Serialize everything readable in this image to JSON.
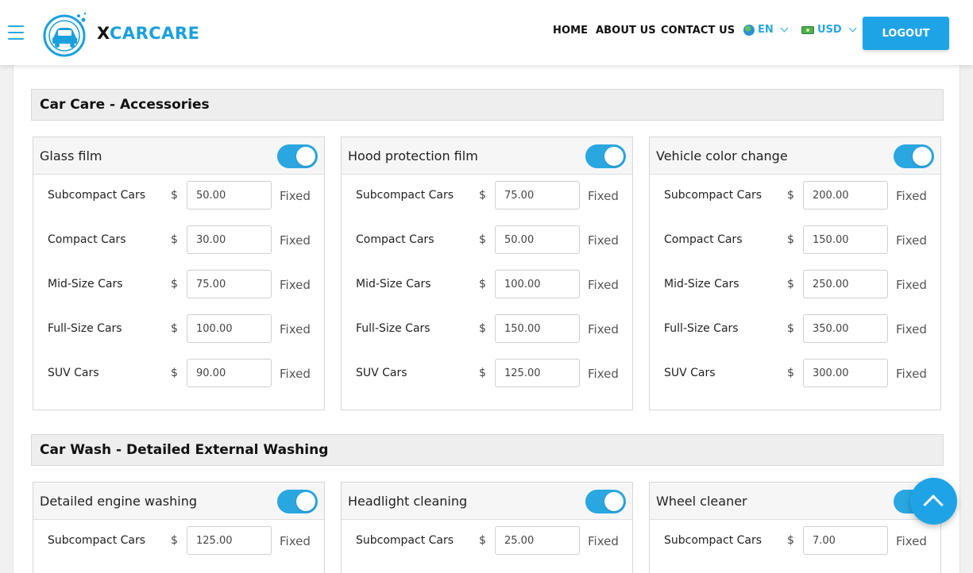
{
  "header": {
    "brand_x": "X",
    "brand_rest": "CARCARE",
    "nav": [
      "HOME",
      "ABOUT US",
      "CONTACT US"
    ],
    "language": "EN",
    "currency": "USD",
    "logout_label": "LOGOUT"
  },
  "sections": [
    {
      "title": "Car Care - Accessories",
      "panels": [
        {
          "title": "Glass film",
          "enabled": true,
          "rows": [
            {
              "label": "Subcompact Cars",
              "currency": "$",
              "value": "50.00",
              "type": "Fixed"
            },
            {
              "label": "Compact Cars",
              "currency": "$",
              "value": "30.00",
              "type": "Fixed"
            },
            {
              "label": "Mid-Size Cars",
              "currency": "$",
              "value": "75.00",
              "type": "Fixed"
            },
            {
              "label": "Full-Size Cars",
              "currency": "$",
              "value": "100.00",
              "type": "Fixed"
            },
            {
              "label": "SUV Cars",
              "currency": "$",
              "value": "90.00",
              "type": "Fixed"
            }
          ]
        },
        {
          "title": "Hood protection film",
          "enabled": true,
          "rows": [
            {
              "label": "Subcompact Cars",
              "currency": "$",
              "value": "75.00",
              "type": "Fixed"
            },
            {
              "label": "Compact Cars",
              "currency": "$",
              "value": "50.00",
              "type": "Fixed"
            },
            {
              "label": "Mid-Size Cars",
              "currency": "$",
              "value": "100.00",
              "type": "Fixed"
            },
            {
              "label": "Full-Size Cars",
              "currency": "$",
              "value": "150.00",
              "type": "Fixed"
            },
            {
              "label": "SUV Cars",
              "currency": "$",
              "value": "125.00",
              "type": "Fixed"
            }
          ]
        },
        {
          "title": "Vehicle color change",
          "enabled": true,
          "rows": [
            {
              "label": "Subcompact Cars",
              "currency": "$",
              "value": "200.00",
              "type": "Fixed"
            },
            {
              "label": "Compact Cars",
              "currency": "$",
              "value": "150.00",
              "type": "Fixed"
            },
            {
              "label": "Mid-Size Cars",
              "currency": "$",
              "value": "250.00",
              "type": "Fixed"
            },
            {
              "label": "Full-Size Cars",
              "currency": "$",
              "value": "350.00",
              "type": "Fixed"
            },
            {
              "label": "SUV Cars",
              "currency": "$",
              "value": "300.00",
              "type": "Fixed"
            }
          ]
        }
      ]
    },
    {
      "title": "Car Wash - Detailed External Washing",
      "panels": [
        {
          "title": "Detailed engine washing",
          "enabled": true,
          "rows": [
            {
              "label": "Subcompact Cars",
              "currency": "$",
              "value": "125.00",
              "type": "Fixed"
            }
          ]
        },
        {
          "title": "Headlight cleaning",
          "enabled": true,
          "rows": [
            {
              "label": "Subcompact Cars",
              "currency": "$",
              "value": "25.00",
              "type": "Fixed"
            }
          ]
        },
        {
          "title": "Wheel cleaner",
          "enabled": true,
          "rows": [
            {
              "label": "Subcompact Cars",
              "currency": "$",
              "value": "7.00",
              "type": "Fixed"
            }
          ]
        }
      ]
    }
  ]
}
